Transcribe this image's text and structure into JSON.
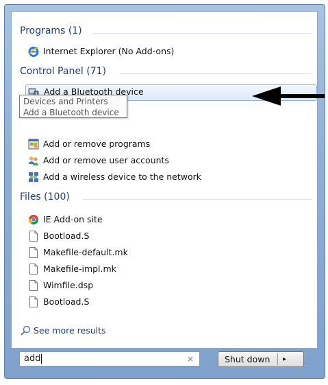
{
  "programs": {
    "header": "Programs (1)",
    "items": [
      {
        "label": "Internet Explorer (No Add-ons)",
        "icon": "internet-explorer-icon"
      }
    ]
  },
  "control_panel": {
    "header": "Control Panel (71)",
    "items": [
      {
        "label": "Add a Bluetooth device",
        "icon": "bluetooth-device-icon",
        "selected": true
      },
      {
        "label": "Add or remove programs",
        "icon": "programs-icon"
      },
      {
        "label": "Add or remove user accounts",
        "icon": "user-accounts-icon"
      },
      {
        "label": "Add a wireless device to the network",
        "icon": "wireless-network-icon"
      }
    ],
    "tooltip": {
      "line1": "Devices and Printers",
      "line2": "Add a Bluetooth device"
    }
  },
  "files": {
    "header": "Files (100)",
    "items": [
      {
        "label": "IE Add-on site",
        "icon": "chrome-icon"
      },
      {
        "label": "Bootload.S",
        "icon": "file-icon"
      },
      {
        "label": "Makefile-default.mk",
        "icon": "file-icon"
      },
      {
        "label": "Makefile-impl.mk",
        "icon": "file-icon"
      },
      {
        "label": "Wimfile.dsp",
        "icon": "file-icon"
      },
      {
        "label": "Bootload.S",
        "icon": "file-icon"
      }
    ]
  },
  "see_more": "See more results",
  "search": {
    "value": "add",
    "clear_glyph": "×"
  },
  "shutdown": {
    "label": "Shut down",
    "arrow": "▸"
  },
  "colors": {
    "header": "#1e3f7a",
    "selection": "#dbe8f8",
    "frame": "#8fb0d6"
  }
}
